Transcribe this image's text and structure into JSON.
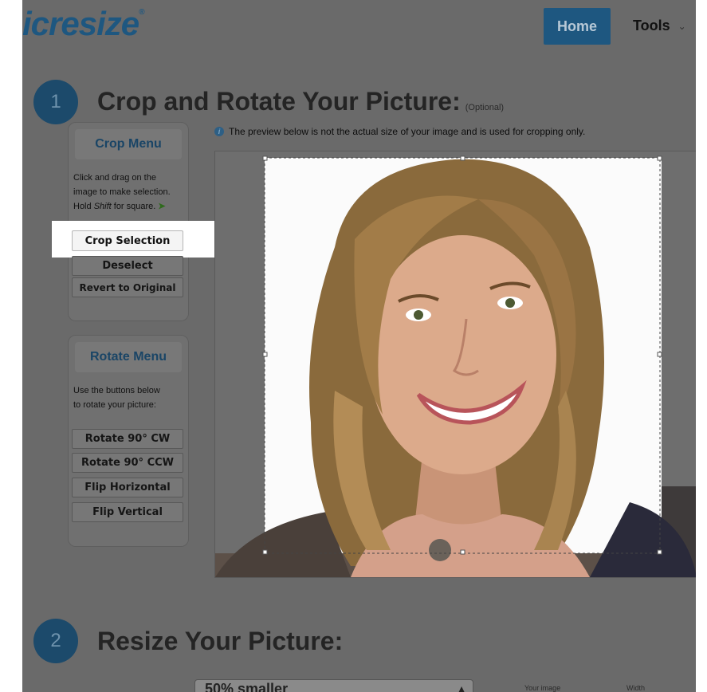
{
  "header": {
    "logo_main": "resize",
    "logo_prefix": "ic",
    "logo_mark": "®",
    "nav": {
      "home": "Home",
      "tools": "Tools"
    },
    "tools_icon": "chevron-down-icon"
  },
  "step1": {
    "number": "1",
    "title": "Crop and Rotate Your Picture:",
    "optional": "(Optional)",
    "info_text": "The preview below is not the actual size of your image and is used for cropping only.",
    "info_icon": "info-icon"
  },
  "crop_menu": {
    "title": "Crop Menu",
    "instruction_1": "Click and drag on the",
    "instruction_2": "image to make selection.",
    "instruction_3_pre": "Hold ",
    "instruction_3_em": "Shift",
    "instruction_3_post": " for square.",
    "arrow_icon": "arrow-right-icon",
    "buttons": {
      "crop_selection": "Crop Selection",
      "deselect": "Deselect",
      "revert": "Revert to Original"
    }
  },
  "rotate_menu": {
    "title": "Rotate Menu",
    "instruction_1": "Use the buttons below",
    "instruction_2": "to rotate your picture:",
    "buttons": {
      "rotate_cw": "Rotate 90° CW",
      "rotate_ccw": "Rotate 90° CCW",
      "flip_h": "Flip Horizontal",
      "flip_v": "Flip Vertical"
    }
  },
  "step2": {
    "number": "2",
    "title": "Resize Your Picture:",
    "select_value": "50% smaller",
    "label_a": "Your image",
    "label_b": "Width"
  },
  "colors": {
    "brand_blue": "#1e5780",
    "overlay_gray": "#6a6a6a",
    "highlight": "#ffffff"
  }
}
